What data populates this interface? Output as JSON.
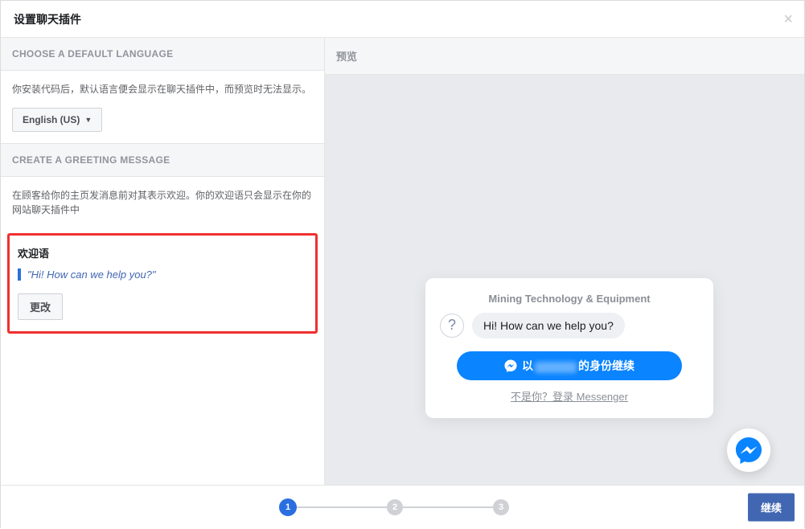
{
  "modal": {
    "title": "设置聊天插件"
  },
  "language_section": {
    "header": "CHOOSE A DEFAULT LANGUAGE",
    "desc": "你安装代码后，默认语言便会显示在聊天插件中，而预览时无法显示。",
    "selected": "English (US)"
  },
  "greeting_section": {
    "header": "CREATE A GREETING MESSAGE",
    "desc": "在顾客给你的主页发消息前对其表示欢迎。你的欢迎语只会显示在你的网站聊天插件中",
    "label": "欢迎语",
    "text": "\"Hi! How can we help you?\"",
    "change": "更改"
  },
  "preview": {
    "header": "预览",
    "page_name": "Mining Technology & Equipment",
    "bubble": "Hi! How can we help you?",
    "continue_prefix": "以",
    "continue_suffix": "的身份继续",
    "notyou": "不是你？登录 Messenger"
  },
  "stepper": {
    "s1": "1",
    "s2": "2",
    "s3": "3"
  },
  "footer": {
    "next": "继续"
  }
}
